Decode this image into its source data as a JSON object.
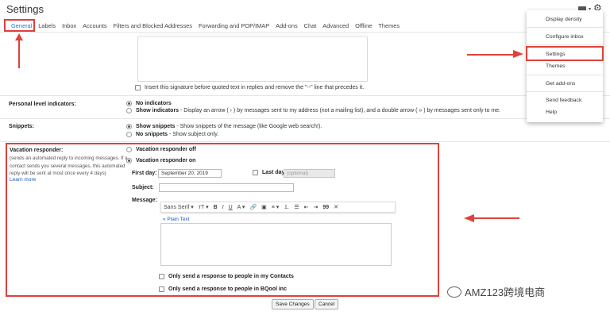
{
  "header": {
    "title": "Settings"
  },
  "tabs": [
    {
      "label": "General",
      "active": true
    },
    {
      "label": "Labels"
    },
    {
      "label": "Inbox"
    },
    {
      "label": "Accounts"
    },
    {
      "label": "Filters and Blocked Addresses"
    },
    {
      "label": "Forwarding and POP/IMAP"
    },
    {
      "label": "Add-ons"
    },
    {
      "label": "Chat"
    },
    {
      "label": "Advanced"
    },
    {
      "label": "Offline"
    },
    {
      "label": "Themes"
    }
  ],
  "signature": {
    "insert_before_quoted": "Insert this signature before quoted text in replies and remove the \"--\" line that precedes it."
  },
  "personal_level": {
    "label": "Personal level indicators:",
    "no_indicators": "No indicators",
    "show_indicators": "Show indicators",
    "show_indicators_desc": "- Display an arrow ( › ) by messages sent to my address (not a mailing list), and a double arrow ( » ) by messages sent only to me."
  },
  "snippets": {
    "label": "Snippets:",
    "show": "Show snippets",
    "show_desc": "- Show snippets of the message (like Google web search!).",
    "no": "No snippets",
    "no_desc": "- Show subject only."
  },
  "vacation": {
    "label": "Vacation responder:",
    "desc_line1": "(sends an automated reply to incoming messages. If a",
    "desc_line2": "contact sends you several messages, this automated",
    "desc_line3": "reply will be sent at most once every 4 days)",
    "learn_more": "Learn more",
    "off": "Vacation responder off",
    "on": "Vacation responder on",
    "first_day_label": "First day:",
    "first_day_value": "September 20, 2019",
    "last_day_label": "Last day:",
    "last_day_placeholder": "(optional)",
    "subject_label": "Subject:",
    "message_label": "Message:",
    "plain_text": "« Plain Text",
    "contacts_only": "Only send a response to people in my Contacts",
    "domain_only": "Only send a response to people in BQool inc"
  },
  "toolbar": {
    "font": "Sans Serif",
    "bold": "B",
    "italic": "I",
    "underline": "U",
    "text_color": "A",
    "quote": "99"
  },
  "actions": {
    "save": "Save Changes",
    "cancel": "Cancel"
  },
  "menu": {
    "items": [
      "Display density",
      "Configure inbox",
      "Settings",
      "Themes",
      "Get add-ons",
      "Send feedback",
      "Help"
    ]
  },
  "watermark": {
    "text": "AMZ123跨境电商"
  },
  "colors": {
    "annotation_red": "#e0413c",
    "link_blue": "#1a73e8"
  }
}
